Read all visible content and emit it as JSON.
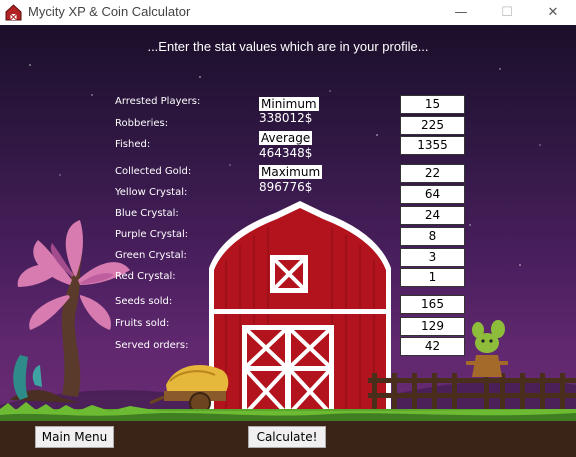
{
  "window": {
    "title": "Mycity XP & Coin Calculator",
    "minimize_glyph": "—",
    "maximize_glyph": "☐",
    "close_glyph": "✕"
  },
  "header": "...Enter the stat values which are in your profile...",
  "stats": [
    {
      "label": "Arrested Players:",
      "value": "15"
    },
    {
      "label": "Robberies:",
      "value": "225"
    },
    {
      "label": "Fished:",
      "value": "1355"
    },
    {
      "label": "Collected Gold:",
      "value": "22"
    },
    {
      "label": "Yellow Crystal:",
      "value": "64"
    },
    {
      "label": "Blue Crystal:",
      "value": "24"
    },
    {
      "label": "Purple Crystal:",
      "value": "8"
    },
    {
      "label": "Green Crystal:",
      "value": "3"
    },
    {
      "label": "Red Crystal:",
      "value": "1"
    },
    {
      "label": "Seeds sold:",
      "value": "165"
    },
    {
      "label": "Fruits sold:",
      "value": "129"
    },
    {
      "label": "Served orders:",
      "value": "42"
    }
  ],
  "results": {
    "minimum_label": "Minimum",
    "minimum_value": "338012$",
    "average_label": "Average",
    "average_value": "464348$",
    "maximum_label": "Maximum",
    "maximum_value": "896776$"
  },
  "buttons": {
    "main_menu": "Main Menu",
    "calculate": "Calculate!"
  }
}
